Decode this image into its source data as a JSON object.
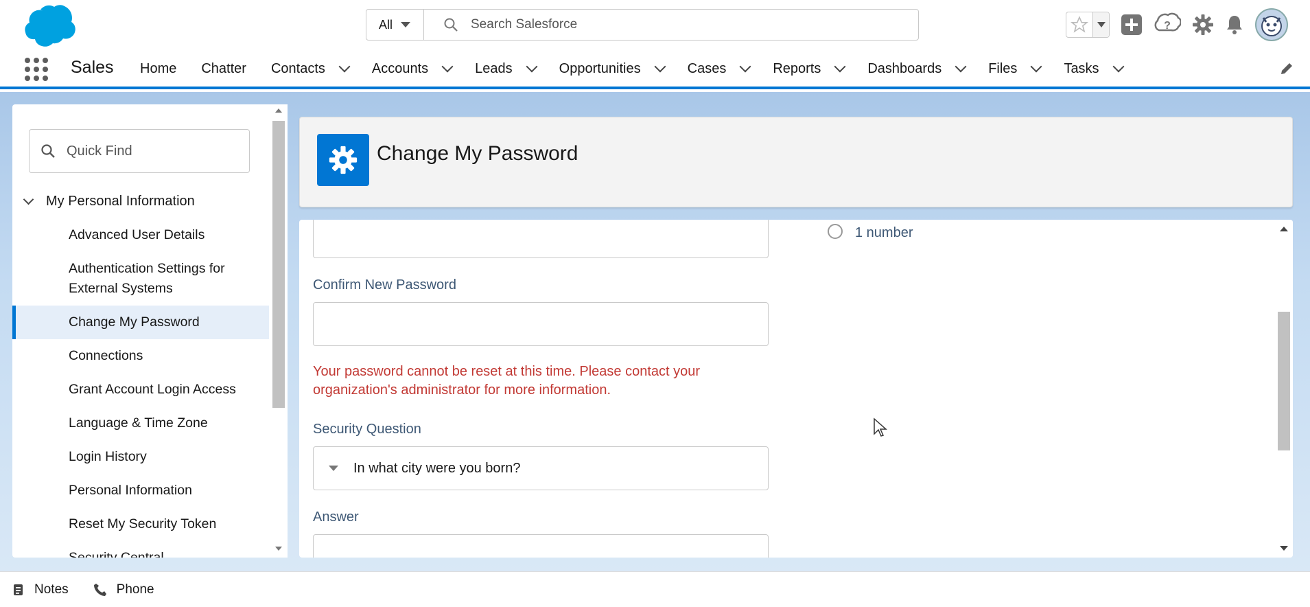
{
  "header": {
    "search_scope": "All",
    "search_placeholder": "Search Salesforce",
    "brand_color": "#00a1e0"
  },
  "nav": {
    "app_name": "Sales",
    "items": [
      {
        "label": "Home",
        "dropdown": false
      },
      {
        "label": "Chatter",
        "dropdown": false
      },
      {
        "label": "Contacts",
        "dropdown": true
      },
      {
        "label": "Accounts",
        "dropdown": true
      },
      {
        "label": "Leads",
        "dropdown": true
      },
      {
        "label": "Opportunities",
        "dropdown": true
      },
      {
        "label": "Cases",
        "dropdown": true
      },
      {
        "label": "Reports",
        "dropdown": true
      },
      {
        "label": "Dashboards",
        "dropdown": true
      },
      {
        "label": "Files",
        "dropdown": true
      },
      {
        "label": "Tasks",
        "dropdown": true
      }
    ],
    "accent_color": "#0176d3"
  },
  "sidebar": {
    "quickfind_placeholder": "Quick Find",
    "section": "My Personal Information",
    "items": [
      {
        "label": "Advanced User Details"
      },
      {
        "label": "Authentication Settings for External Systems"
      },
      {
        "label": "Change My Password",
        "selected": true
      },
      {
        "label": "Connections"
      },
      {
        "label": "Grant Account Login Access"
      },
      {
        "label": "Language & Time Zone"
      },
      {
        "label": "Login History"
      },
      {
        "label": "Personal Information"
      },
      {
        "label": "Reset My Security Token"
      },
      {
        "label": "Security Central"
      }
    ]
  },
  "page": {
    "title": "Change My Password",
    "icon": "gear-icon"
  },
  "form": {
    "confirm_label": "Confirm New Password",
    "error": "Your password cannot be reset at this time. Please contact your organization's administrator for more information.",
    "security_question_label": "Security Question",
    "security_question_value": "In what city were you born?",
    "answer_label": "Answer",
    "requirement": "1 number",
    "error_color": "#c23934"
  },
  "utility": {
    "items": [
      {
        "label": "Notes",
        "icon": "notes-icon"
      },
      {
        "label": "Phone",
        "icon": "phone-icon"
      }
    ]
  }
}
